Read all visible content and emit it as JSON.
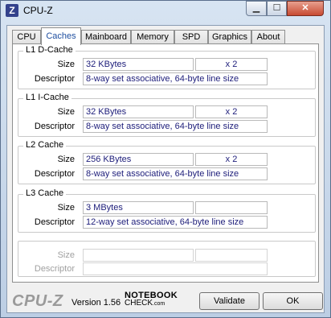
{
  "window": {
    "title": "CPU-Z",
    "icon_letter": "Z",
    "controls": {
      "minimize": "▁",
      "maximize": "☐",
      "close": "✕"
    }
  },
  "tabs": [
    "CPU",
    "Caches",
    "Mainboard",
    "Memory",
    "SPD",
    "Graphics",
    "About"
  ],
  "active_tab": "Caches",
  "labels": {
    "size": "Size",
    "descriptor": "Descriptor"
  },
  "caches": [
    {
      "title": "L1 D-Cache",
      "size": "32 KBytes",
      "count": "x 2",
      "descriptor": "8-way set associative, 64-byte line size"
    },
    {
      "title": "L1 I-Cache",
      "size": "32 KBytes",
      "count": "x 2",
      "descriptor": "8-way set associative, 64-byte line size"
    },
    {
      "title": "L2 Cache",
      "size": "256 KBytes",
      "count": "x 2",
      "descriptor": "8-way set associative, 64-byte line size"
    },
    {
      "title": "L3 Cache",
      "size": "3 MBytes",
      "count": "",
      "descriptor": "12-way set associative, 64-byte line size"
    }
  ],
  "footer": {
    "brand": "CPU-Z",
    "version": "Version 1.56",
    "notebookcheck_top": "NOTEBOOK",
    "notebookcheck_bottom": "CHECK",
    "notebookcheck_suffix": ".com",
    "validate_label": "Validate",
    "ok_label": "OK"
  }
}
